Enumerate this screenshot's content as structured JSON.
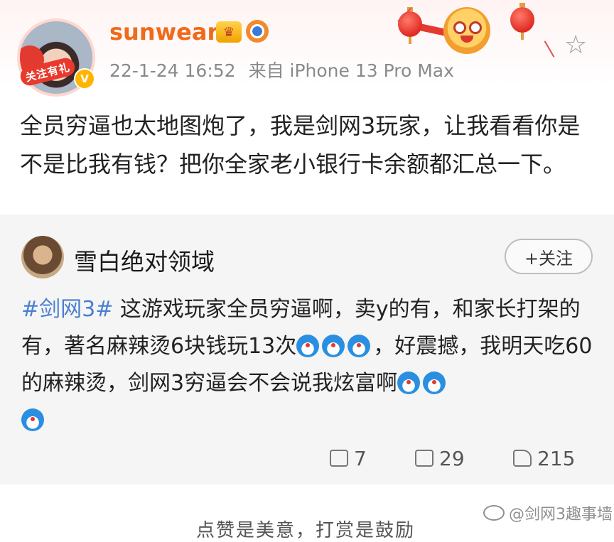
{
  "post": {
    "username": "sunwear",
    "avatar_badge": "关注有礼",
    "verified_mark": "V",
    "date": "22-1-24 16:52",
    "source": "来自 iPhone 13 Pro Max",
    "text": "全员穷逼也太地图炮了，我是剑网3玩家，让我看看你是不是比我有钱？把你全家老小银行卡余额都汇总一下。",
    "icons": [
      "vip-crown-icon",
      "medal-icon",
      "star-icon"
    ]
  },
  "repost": {
    "author": "雪白绝对领域",
    "follow_label": "+关注",
    "hashtag": "#剑网3#",
    "text_1": " 这游戏玩家全员穷逼啊，卖y的有，和家长打架的有，著名麻辣烫6块钱玩13次",
    "text_2": "，好震撼，我明天吃60的麻辣烫，剑网3穷逼会不会说我炫富啊",
    "emoji_icon": "doraemon-emoji-icon",
    "share_count": "7",
    "comment_count": "29",
    "like_count": "215"
  },
  "footer": {
    "cut_text": "点赞是美意，打赏是鼓励",
    "watermark": "@剑网3趣事墙"
  },
  "colors": {
    "username": "#f06a1a",
    "hashtag": "#4a7fd1",
    "meta": "#8a8a8a"
  }
}
